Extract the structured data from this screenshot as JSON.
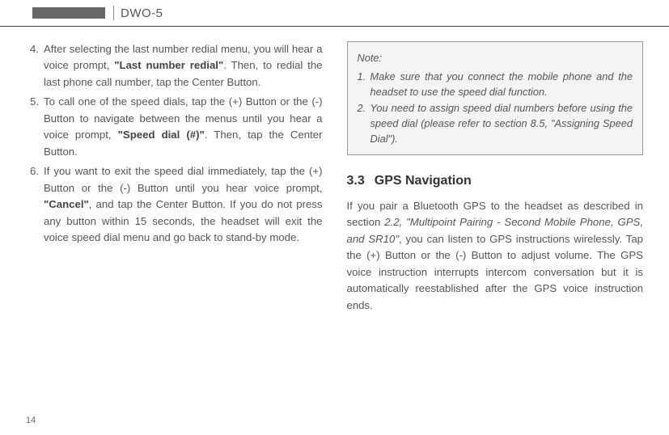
{
  "header": {
    "model": "DWO-5"
  },
  "left": {
    "items": [
      {
        "num": "4.",
        "before": "After selecting the last number redial menu, you will hear a voice prompt, ",
        "bold": "\"Last number redial\"",
        "after": ". Then, to redial the last phone call number, tap the Center Button."
      },
      {
        "num": "5.",
        "before": "To call one of the speed dials, tap the (+) Button or the (-) Button to navigate between the menus until you hear a voice prompt, ",
        "bold": "\"Speed dial (#)\"",
        "after": ". Then, tap the Center Button."
      },
      {
        "num": "6.",
        "before": "If you want to exit the speed dial immediately, tap the (+) Button or the (-) Button until you hear voice prompt, ",
        "bold": "\"Cancel\"",
        "after": ", and tap the Center Button. If you do not press any button within 15 seconds, the headset will exit the voice speed dial menu and go back to stand-by mode."
      }
    ]
  },
  "note": {
    "title": "Note:",
    "items": [
      {
        "num": "1.",
        "text": "Make sure that you connect the mobile phone and the headset to use the speed dial function."
      },
      {
        "num": "2.",
        "text": "You need to assign speed dial numbers before using the speed dial (please refer to section 8.5, \"Assigning Speed Dial\")."
      }
    ]
  },
  "section": {
    "num": "3.3",
    "title": "GPS Navigation",
    "body_before": "If you pair a Bluetooth GPS to the headset as described in section ",
    "body_ital": "2.2, \"Multipoint Pairing - Second Mobile Phone, GPS, and SR10\"",
    "body_after": ", you can listen to GPS instructions wirelessly. Tap the (+) Button or the (-) Button to adjust volume. The GPS voice instruction interrupts intercom conversation but it is automatically reestablished after the GPS voice instruction ends."
  },
  "page": "14"
}
